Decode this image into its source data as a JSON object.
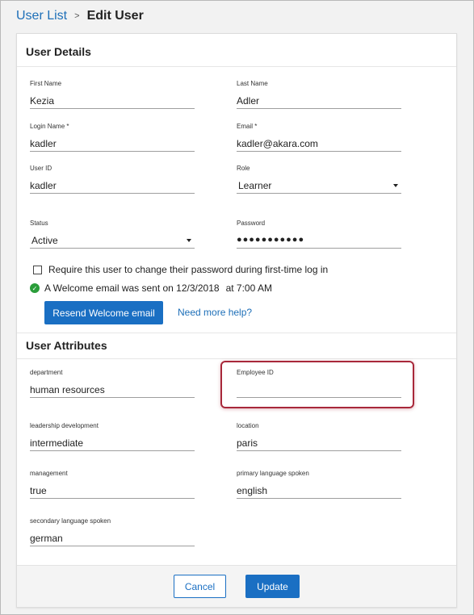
{
  "breadcrumb": {
    "parent": "User List",
    "separator": ">",
    "current": "Edit User"
  },
  "user_details": {
    "title": "User Details",
    "first_name": {
      "label": "First Name",
      "value": "Kezia"
    },
    "last_name": {
      "label": "Last Name",
      "value": "Adler"
    },
    "login_name": {
      "label": "Login Name *",
      "value": "kadler"
    },
    "email": {
      "label": "Email *",
      "value": "kadler@akara.com"
    },
    "user_id": {
      "label": "User ID",
      "value": "kadler"
    },
    "role": {
      "label": "Role",
      "value": "Learner"
    },
    "status": {
      "label": "Status",
      "value": "Active"
    },
    "password": {
      "label": "Password",
      "value": "●●●●●●●●●●●"
    },
    "require_change_label": "Require this user to change their password during first-time log in",
    "welcome_message": "A Welcome email was sent on 12/3/2018",
    "welcome_time": "at 7:00 AM",
    "resend_button": "Resend Welcome email",
    "help_link": "Need more help?"
  },
  "user_attributes": {
    "title": "User Attributes",
    "department": {
      "label": "department",
      "value": "human resources"
    },
    "employee_id": {
      "label": "Employee ID",
      "value": ""
    },
    "leadership_development": {
      "label": "leadership development",
      "value": "intermediate"
    },
    "location": {
      "label": "location",
      "value": "paris"
    },
    "management": {
      "label": "management",
      "value": "true"
    },
    "primary_language": {
      "label": "primary language spoken",
      "value": "english"
    },
    "secondary_language": {
      "label": "secondary language spoken",
      "value": "german"
    }
  },
  "footer": {
    "cancel": "Cancel",
    "update": "Update"
  },
  "colors": {
    "accent": "#1a6fc3",
    "success": "#2a9d3a",
    "highlight": "#a8283a"
  }
}
